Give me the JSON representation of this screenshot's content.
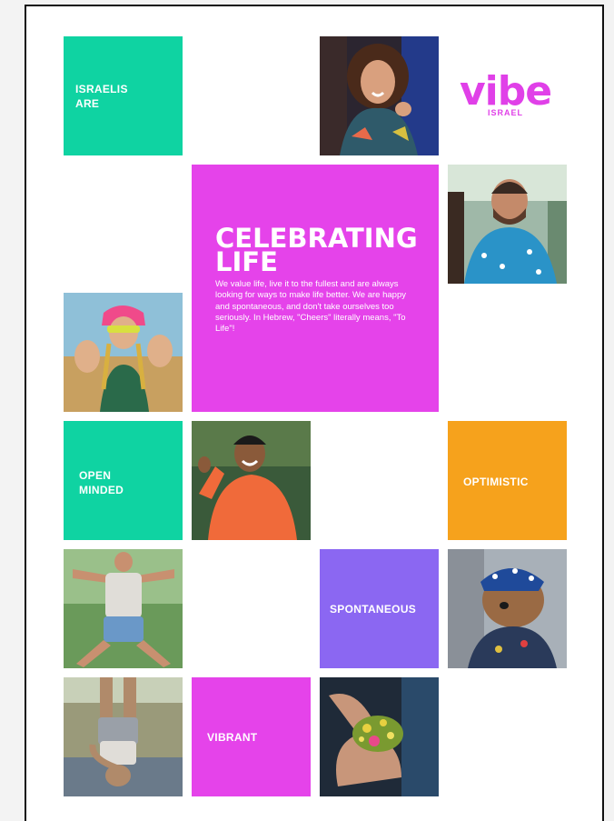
{
  "brand": {
    "logo_word": "vibe",
    "logo_sub": "ISRAEL",
    "color": "#e040e8"
  },
  "hero": {
    "title": "CELEBRATING\nLIFE",
    "body": "We value life, live it to the fullest and are always looking for ways to make life better. We are happy and spontaneous, and don't take ourselves too seriously. In Hebrew, \"Cheers\" literally means, \"To Life\"!"
  },
  "tiles": {
    "israelis_are": "ISRAELIS\nARE",
    "open_minded": "OPEN\nMINDED",
    "optimistic": "OPTIMISTIC",
    "spontaneous": "SPONTANEOUS",
    "vibrant": "VIBRANT"
  },
  "colors": {
    "green": "#0fd3a2",
    "magenta": "#e543ea",
    "orange": "#f6a21c",
    "purple": "#8b67f2"
  },
  "photos": [
    {
      "name": "woman-laughing-photo"
    },
    {
      "name": "bearded-man-photo"
    },
    {
      "name": "festival-woman-photo"
    },
    {
      "name": "smiling-man-orange-jacket-photo"
    },
    {
      "name": "man-acro-yoga-photo"
    },
    {
      "name": "dog-bandana-photo"
    },
    {
      "name": "yoga-on-mat-photo"
    },
    {
      "name": "flowers-in-hands-photo"
    }
  ]
}
